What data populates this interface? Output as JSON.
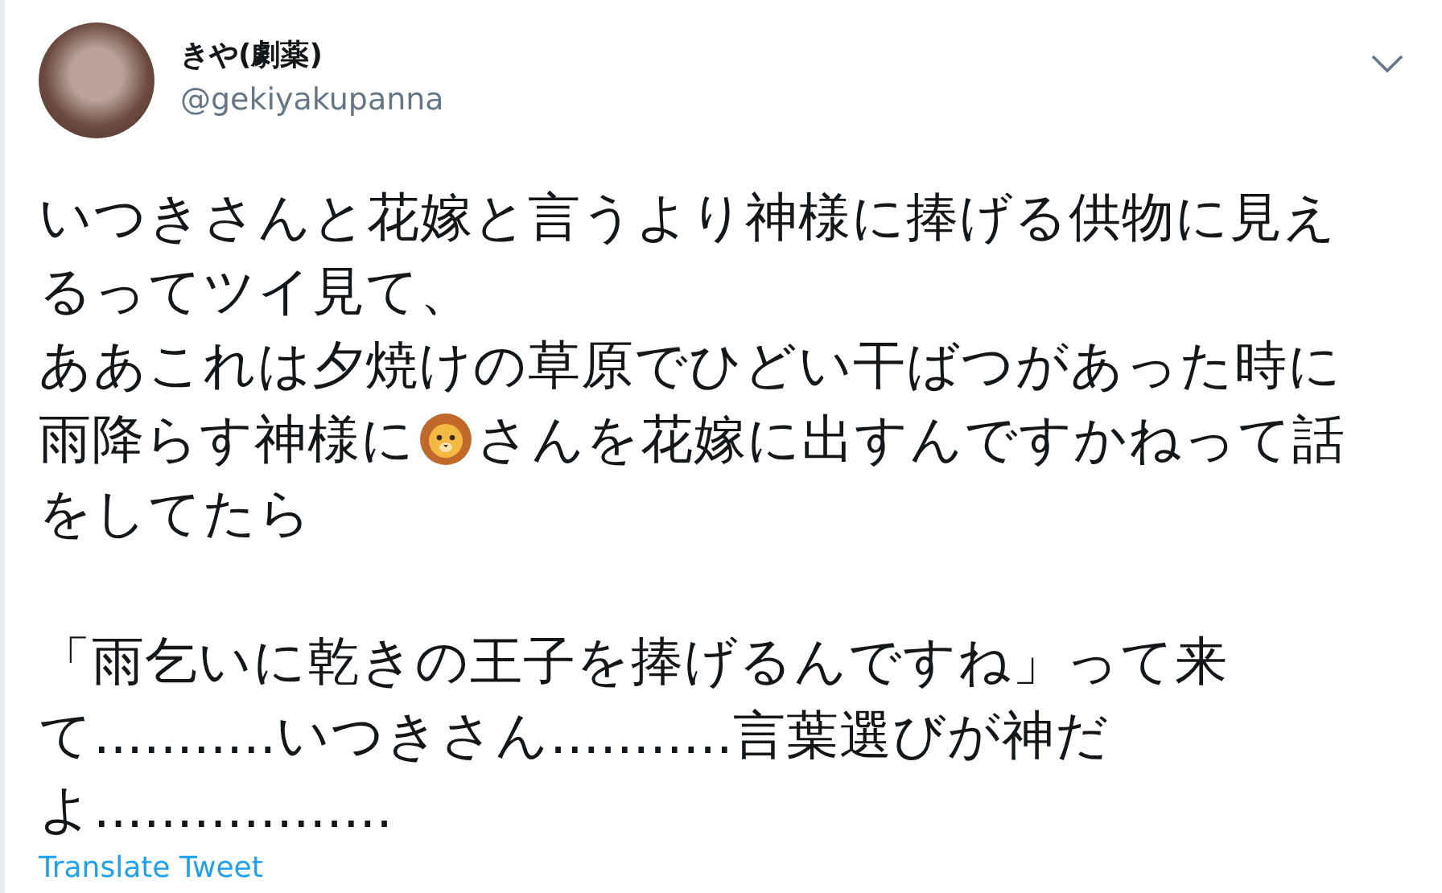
{
  "author": {
    "name": "きや(劇薬)",
    "handle": "@gekiyakupanna"
  },
  "body": {
    "lines": [
      {
        "kind": "text",
        "text": "いつきさんと花嫁と言うより神様に捧げる供物に見え"
      },
      {
        "kind": "text",
        "text": "るってツイ見て、"
      },
      {
        "kind": "text",
        "text": "ああこれは夕焼けの草原でひどい干ばつがあった時に"
      },
      {
        "kind": "emoji",
        "before": "雨降らす神様に",
        "after": "さんを花嫁に出すんですかねって話"
      },
      {
        "kind": "text",
        "text": "をしてたら"
      },
      {
        "kind": "blank"
      },
      {
        "kind": "text",
        "text": "「雨乞いに乾きの王子を捧げるんですね」って来"
      },
      {
        "kind": "text",
        "text": "て...........いつきさん...........言葉選びが神だ"
      },
      {
        "kind": "text",
        "text": "よ.................."
      }
    ]
  },
  "translate_link": "Translate Tweet"
}
